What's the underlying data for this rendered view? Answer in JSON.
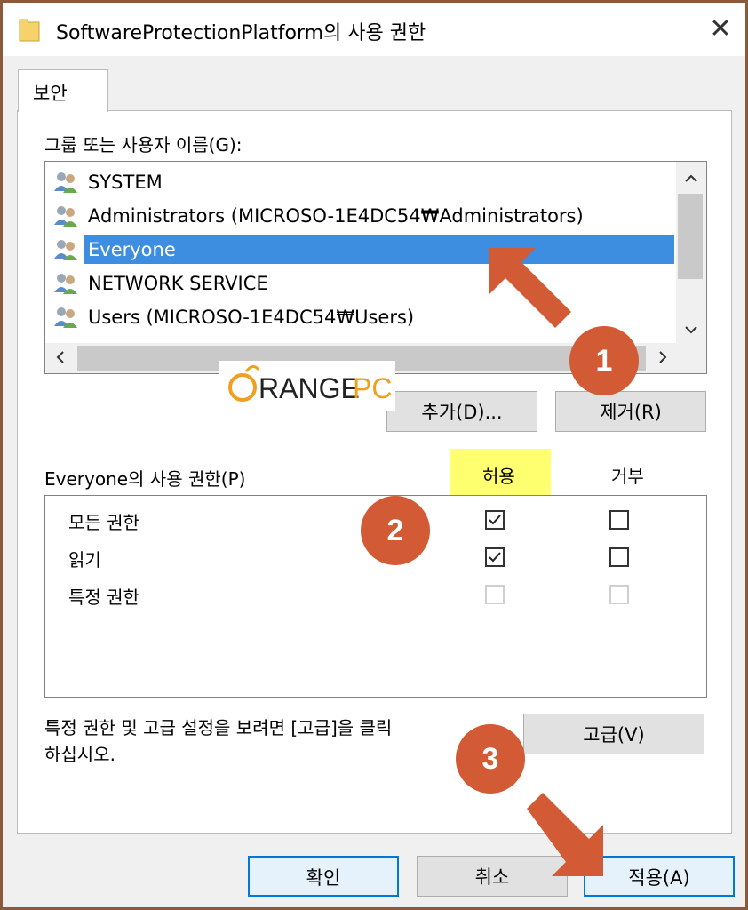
{
  "window": {
    "title": "SoftwareProtectionPlatform의 사용 권한",
    "close_glyph": "✕"
  },
  "tab": {
    "label": "보안"
  },
  "groups": {
    "label": "그룹 또는 사용자 이름(G):",
    "items": [
      {
        "label": "SYSTEM",
        "selected": false
      },
      {
        "label": "Administrators (MICROSO-1E4DC54₩Administrators)",
        "selected": false
      },
      {
        "label": "Everyone",
        "selected": true
      },
      {
        "label": "NETWORK SERVICE",
        "selected": false
      },
      {
        "label": "Users (MICROSO-1E4DC54₩Users)",
        "selected": false
      }
    ]
  },
  "buttons": {
    "add": "추가(D)...",
    "remove": "제거(R)",
    "advanced": "고급(V)",
    "ok": "확인",
    "cancel": "취소",
    "apply": "적용(A)"
  },
  "permissions": {
    "label": "Everyone의 사용 권한(P)",
    "allow_header": "허용",
    "deny_header": "거부",
    "rows": [
      {
        "name": "모든 권한",
        "allow": true,
        "deny": false,
        "disabled": false
      },
      {
        "name": "읽기",
        "allow": true,
        "deny": false,
        "disabled": false
      },
      {
        "name": "특정 권한",
        "allow": false,
        "deny": false,
        "disabled": true
      }
    ]
  },
  "advanced_text": {
    "line1": "특정 권한 및 고급 설정을 보려면 [고급]을 클릭",
    "line2": "하십시오."
  },
  "annotations": {
    "badge1": "1",
    "badge2": "2",
    "badge3": "3",
    "arrow_color": "#d25a34",
    "highlight_color": "#ffff57"
  },
  "watermark": {
    "brand": "ORANGEPC"
  }
}
